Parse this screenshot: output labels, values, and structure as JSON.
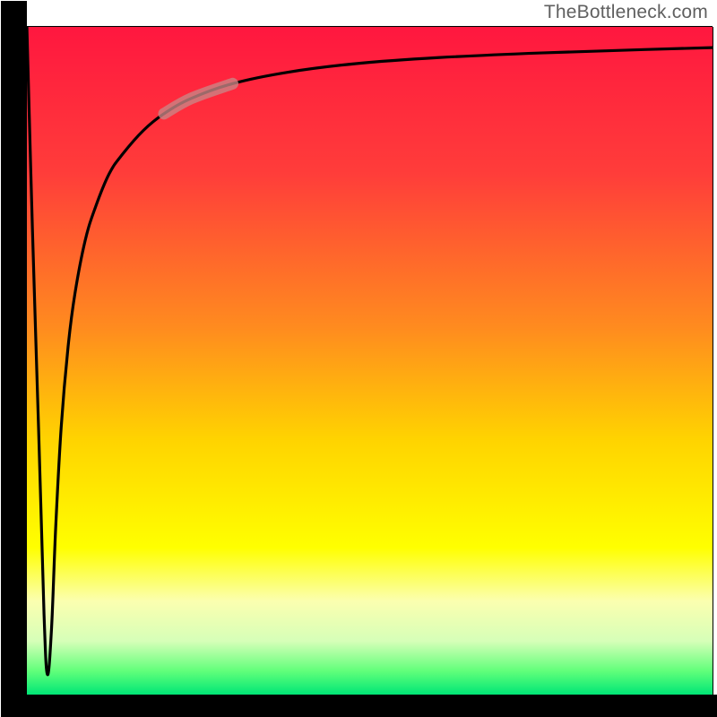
{
  "attribution": "TheBottleneck.com",
  "colors": {
    "gradient_stops": [
      {
        "offset": 0.0,
        "color": "#ff173f"
      },
      {
        "offset": 0.22,
        "color": "#ff3d3a"
      },
      {
        "offset": 0.45,
        "color": "#ff8b1f"
      },
      {
        "offset": 0.62,
        "color": "#ffd400"
      },
      {
        "offset": 0.78,
        "color": "#ffff00"
      },
      {
        "offset": 0.86,
        "color": "#fbffb0"
      },
      {
        "offset": 0.92,
        "color": "#d6ffb8"
      },
      {
        "offset": 0.965,
        "color": "#60ff7a"
      },
      {
        "offset": 1.0,
        "color": "#00e676"
      }
    ],
    "curve": "#000000",
    "highlight": "#c98787",
    "frame": "#000000"
  },
  "chart_data": {
    "type": "line",
    "title": "",
    "xlabel": "",
    "ylabel": "",
    "xlim": [
      0,
      100
    ],
    "ylim": [
      0,
      100
    ],
    "grid": false,
    "series": [
      {
        "name": "bottleneck-curve",
        "x": [
          0.0,
          0.8,
          1.7,
          2.5,
          3.0,
          3.6,
          4.2,
          5.0,
          6.0,
          7.0,
          8.5,
          10.0,
          12.0,
          14.0,
          17.0,
          20.0,
          24.0,
          30.0,
          38.0,
          48.0,
          60.0,
          75.0,
          90.0,
          100.0
        ],
        "y": [
          100,
          70,
          40,
          12,
          3,
          10,
          25,
          40,
          52,
          60,
          68,
          73,
          78,
          81,
          84.5,
          87,
          89.3,
          91.5,
          93.2,
          94.5,
          95.4,
          96.1,
          96.6,
          96.9
        ]
      }
    ],
    "highlight_segment": {
      "x_start": 20.0,
      "x_end": 30.0
    },
    "legend": false
  }
}
